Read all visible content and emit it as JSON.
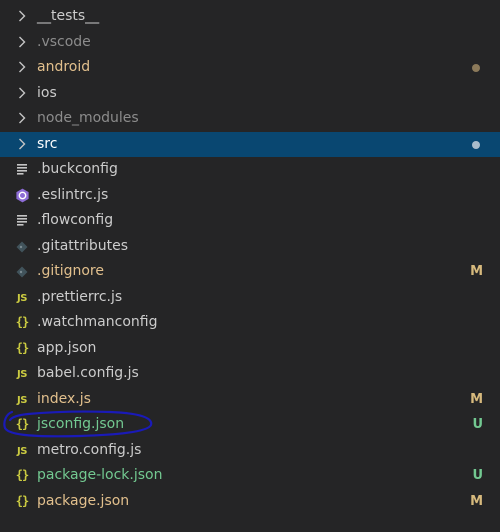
{
  "colors": {
    "background": "#252526",
    "selected_background": "#094771",
    "default_text": "#cccccc",
    "ignored_text": "#8c8c8c",
    "modified_text": "#e2c08d",
    "untracked_text": "#73c991",
    "modified_badge": "#d7ba7d",
    "untracked_badge": "#73c991",
    "annotation_ink": "#1a1ab8"
  },
  "explorer": {
    "items": [
      {
        "label": "__tests__",
        "kind": "folder",
        "icon": "chevron-right-icon",
        "status": "none",
        "badge": ""
      },
      {
        "label": ".vscode",
        "kind": "folder",
        "icon": "chevron-right-icon",
        "status": "ignored",
        "badge": ""
      },
      {
        "label": "android",
        "kind": "folder",
        "icon": "chevron-right-icon",
        "status": "modified",
        "badge": "dot"
      },
      {
        "label": "ios",
        "kind": "folder",
        "icon": "chevron-right-icon",
        "status": "none",
        "badge": ""
      },
      {
        "label": "node_modules",
        "kind": "folder",
        "icon": "chevron-right-icon",
        "status": "ignored",
        "badge": ""
      },
      {
        "label": "src",
        "kind": "folder",
        "icon": "chevron-right-icon",
        "status": "selected",
        "badge": "dot"
      },
      {
        "label": ".buckconfig",
        "kind": "file",
        "icon": "lines-icon",
        "status": "none",
        "badge": ""
      },
      {
        "label": ".eslintrc.js",
        "kind": "file",
        "icon": "eslint-icon",
        "status": "none",
        "badge": ""
      },
      {
        "label": ".flowconfig",
        "kind": "file",
        "icon": "lines-icon",
        "status": "none",
        "badge": ""
      },
      {
        "label": ".gitattributes",
        "kind": "file",
        "icon": "git-diamond-icon",
        "status": "none",
        "badge": ""
      },
      {
        "label": ".gitignore",
        "kind": "file",
        "icon": "git-diamond-icon",
        "status": "modified",
        "badge": "M"
      },
      {
        "label": ".prettierrc.js",
        "kind": "file",
        "icon": "js-icon",
        "status": "none",
        "badge": ""
      },
      {
        "label": ".watchmanconfig",
        "kind": "file",
        "icon": "json-braces-icon",
        "status": "none",
        "badge": ""
      },
      {
        "label": "app.json",
        "kind": "file",
        "icon": "json-braces-icon",
        "status": "none",
        "badge": ""
      },
      {
        "label": "babel.config.js",
        "kind": "file",
        "icon": "js-icon",
        "status": "none",
        "badge": ""
      },
      {
        "label": "index.js",
        "kind": "file",
        "icon": "js-icon",
        "status": "modified",
        "badge": "M"
      },
      {
        "label": "jsconfig.json",
        "kind": "file",
        "icon": "json-braces-icon",
        "status": "untracked",
        "badge": "U"
      },
      {
        "label": "metro.config.js",
        "kind": "file",
        "icon": "js-icon",
        "status": "none",
        "badge": ""
      },
      {
        "label": "package-lock.json",
        "kind": "file",
        "icon": "json-braces-icon",
        "status": "untracked",
        "badge": "U"
      },
      {
        "label": "package.json",
        "kind": "file",
        "icon": "json-braces-icon",
        "status": "modified",
        "badge": "M"
      }
    ]
  },
  "icon_glyphs": {
    "js": "JS",
    "json": "{}"
  }
}
